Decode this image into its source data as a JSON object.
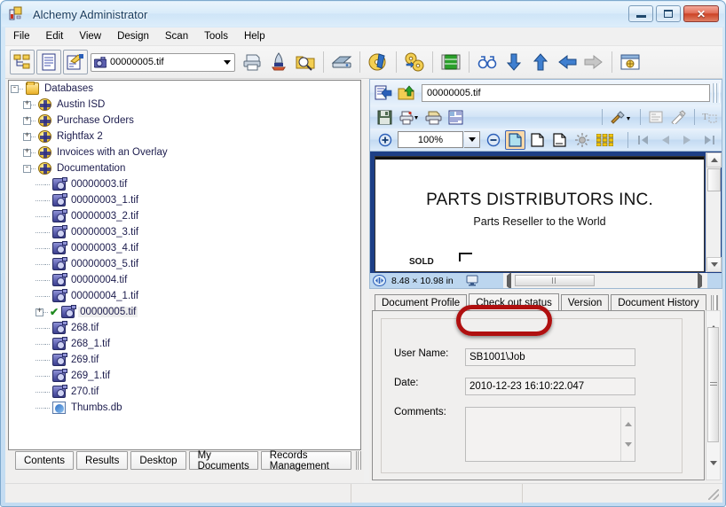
{
  "window": {
    "title": "Alchemy Administrator",
    "minimize_label": "Minimize",
    "maximize_label": "Maximize",
    "close_label": "✕"
  },
  "menu": {
    "items": [
      "File",
      "Edit",
      "View",
      "Design",
      "Scan",
      "Tools",
      "Help"
    ]
  },
  "toolbar": {
    "combo_value": "00000005.tif",
    "buttons": [
      {
        "name": "tree-view-button",
        "title": "Tree View"
      },
      {
        "name": "document-view-button",
        "title": "Document View"
      },
      {
        "name": "edit-profile-button",
        "title": "Edit Profile"
      },
      {
        "name": "print-button",
        "title": "Print"
      },
      {
        "name": "ocr-button",
        "title": "OCR"
      },
      {
        "name": "search-button",
        "title": "Search"
      },
      {
        "name": "scan-button",
        "title": "Scan"
      },
      {
        "name": "build-button",
        "title": "Build"
      },
      {
        "name": "copy-disc-button",
        "title": "Copy Disc"
      },
      {
        "name": "filmstrip-button",
        "title": "Film Strip"
      },
      {
        "name": "find-button",
        "title": "Find"
      },
      {
        "name": "move-down-button",
        "title": "Move Down"
      },
      {
        "name": "move-up-button",
        "title": "Move Up"
      },
      {
        "name": "back-button",
        "title": "Back"
      },
      {
        "name": "forward-button",
        "title": "Forward"
      },
      {
        "name": "properties-button",
        "title": "Properties"
      }
    ]
  },
  "tree": {
    "root": "Databases",
    "nodes": [
      {
        "label": "Databases",
        "depth": 0,
        "icon": "folder",
        "expander": "-",
        "selected": false
      },
      {
        "label": "Austin ISD",
        "depth": 1,
        "icon": "database",
        "expander": "+",
        "selected": false
      },
      {
        "label": "Purchase Orders",
        "depth": 1,
        "icon": "database",
        "expander": "+",
        "selected": false
      },
      {
        "label": "Rightfax 2",
        "depth": 1,
        "icon": "database",
        "expander": "+",
        "selected": false
      },
      {
        "label": "Invoices with an Overlay",
        "depth": 1,
        "icon": "database",
        "expander": "+",
        "selected": false
      },
      {
        "label": "Documentation",
        "depth": 1,
        "icon": "database",
        "expander": "-",
        "selected": false
      },
      {
        "label": "00000003.tif",
        "depth": 2,
        "icon": "tif",
        "expander": "",
        "selected": false
      },
      {
        "label": "00000003_1.tif",
        "depth": 2,
        "icon": "tif",
        "expander": "",
        "selected": false
      },
      {
        "label": "00000003_2.tif",
        "depth": 2,
        "icon": "tif",
        "expander": "",
        "selected": false
      },
      {
        "label": "00000003_3.tif",
        "depth": 2,
        "icon": "tif",
        "expander": "",
        "selected": false
      },
      {
        "label": "00000003_4.tif",
        "depth": 2,
        "icon": "tif",
        "expander": "",
        "selected": false
      },
      {
        "label": "00000003_5.tif",
        "depth": 2,
        "icon": "tif",
        "expander": "",
        "selected": false
      },
      {
        "label": "00000004.tif",
        "depth": 2,
        "icon": "tif",
        "expander": "",
        "selected": false
      },
      {
        "label": "00000004_1.tif",
        "depth": 2,
        "icon": "tif",
        "expander": "",
        "selected": false
      },
      {
        "label": "00000005.tif",
        "depth": 2,
        "icon": "tif",
        "expander": "+",
        "selected": true,
        "checked": true
      },
      {
        "label": "268.tif",
        "depth": 2,
        "icon": "tif",
        "expander": "",
        "selected": false
      },
      {
        "label": "268_1.tif",
        "depth": 2,
        "icon": "tif",
        "expander": "",
        "selected": false
      },
      {
        "label": "269.tif",
        "depth": 2,
        "icon": "tif",
        "expander": "",
        "selected": false
      },
      {
        "label": "269_1.tif",
        "depth": 2,
        "icon": "tif",
        "expander": "",
        "selected": false
      },
      {
        "label": "270.tif",
        "depth": 2,
        "icon": "tif",
        "expander": "",
        "selected": false
      },
      {
        "label": "Thumbs.db",
        "depth": 2,
        "icon": "thumb",
        "expander": "",
        "selected": false
      }
    ]
  },
  "left_tabs": {
    "items": [
      "Contents",
      "Results",
      "Desktop",
      "My Documents",
      "Records Management"
    ],
    "selected": "Contents"
  },
  "viewer": {
    "path_value": "00000005.tif",
    "zoom": "100%",
    "toolbar_row1": [
      {
        "name": "save-button",
        "title": "Save"
      },
      {
        "name": "print-setup-button",
        "title": "Print Setup"
      },
      {
        "name": "print-button",
        "title": "Print"
      },
      {
        "name": "page-layout-button",
        "title": "Page Layout"
      },
      {
        "name": "annotation-tools-button",
        "title": "Annotation Tools"
      },
      {
        "name": "text-note-button",
        "title": "Text Note"
      },
      {
        "name": "highlighter-button",
        "title": "Highlighter"
      },
      {
        "name": "text-select-button",
        "title": "Text Select"
      }
    ],
    "toolbar_row2": [
      {
        "name": "zoom-in-button",
        "title": "Zoom In"
      },
      {
        "name": "zoom-out-button",
        "title": "Zoom Out"
      },
      {
        "name": "fit-page-button",
        "title": "Fit Page"
      },
      {
        "name": "fit-width-button",
        "title": "Fit Width"
      },
      {
        "name": "actual-size-button",
        "title": "Actual Size"
      },
      {
        "name": "brightness-button",
        "title": "Brightness"
      },
      {
        "name": "thumbnails-button",
        "title": "Thumbnails"
      },
      {
        "name": "first-page-button",
        "title": "First Page"
      },
      {
        "name": "previous-page-button",
        "title": "Previous Page"
      },
      {
        "name": "next-page-button",
        "title": "Next Page"
      },
      {
        "name": "last-page-button",
        "title": "Last Page"
      }
    ],
    "document": {
      "company": "PARTS DISTRIBUTORS INC.",
      "tagline": "Parts Reseller to the World",
      "field_label": "SOLD"
    },
    "status_dimensions": "8.48 × 10.98 in"
  },
  "detail_tabs": {
    "items": [
      "Document Profile",
      "Check out status",
      "Version",
      "Document History"
    ],
    "selected": "Check out status"
  },
  "checkout_form": {
    "user_name_label": "User Name:",
    "user_name_value": "SB1001\\Job",
    "date_label": "Date:",
    "date_value": "2010-12-23 16:10:22.047",
    "comments_label": "Comments:",
    "comments_value": ""
  },
  "status_bar": {
    "pane1": "",
    "pane2": "",
    "pane3": ""
  },
  "colors": {
    "annotation_red": "#b01010",
    "title_text": "#14395c",
    "viewer_background": "#1d3f86",
    "selection_gray": "#ededed"
  }
}
